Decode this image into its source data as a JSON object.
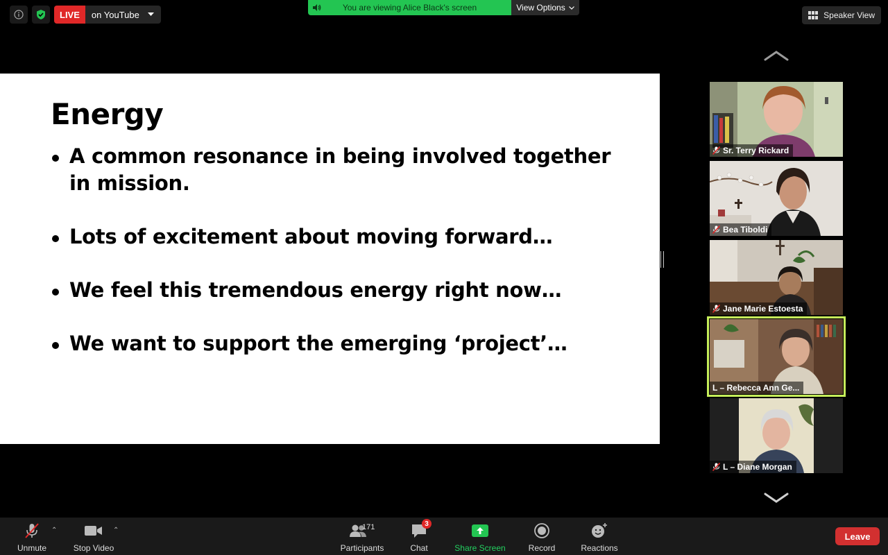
{
  "topbar": {
    "live_badge": "LIVE",
    "live_platform": "on YouTube",
    "share_banner_text": "You are viewing Alice Black's screen",
    "view_options": "View Options",
    "speaker_view": "Speaker View"
  },
  "slide": {
    "title": "Energy",
    "bullets": [
      "A common resonance in being involved together in mission.",
      "Lots of excitement about moving forward…",
      "We feel this tremendous energy right now…",
      "We want to support the emerging ‘project’…"
    ]
  },
  "participants": [
    {
      "name": "Sr. Terry Rickard",
      "muted": true
    },
    {
      "name": "Bea Tiboldi",
      "muted": true
    },
    {
      "name": "Jane Marie Estoesta",
      "muted": true
    },
    {
      "name": "L – Rebecca Ann Ge...",
      "muted": false,
      "active_speaker": true
    },
    {
      "name": "L – Diane Morgan",
      "muted": true
    }
  ],
  "toolbar": {
    "unmute": "Unmute",
    "stop_video": "Stop Video",
    "participants": "Participants",
    "participants_count": "171",
    "chat": "Chat",
    "chat_badge": "3",
    "share_screen": "Share Screen",
    "record": "Record",
    "reactions": "Reactions",
    "leave": "Leave"
  },
  "colors": {
    "live_red": "#e02828",
    "share_green": "#23c552",
    "active_speaker_outline": "#c6ee5a",
    "leave_red": "#d23030"
  }
}
